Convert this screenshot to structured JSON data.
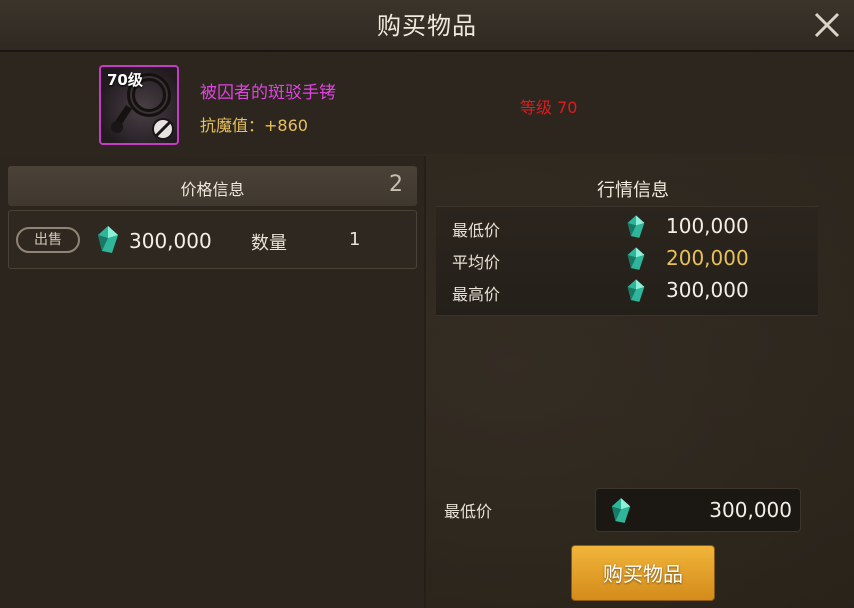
{
  "window": {
    "title": "购买物品"
  },
  "item": {
    "level_badge": "70级",
    "name": "被囚者的斑驳手铐",
    "stat": "抗魔值：+860",
    "level_requirement": "等级 70",
    "icon": "handcuff-icon",
    "name_color": "#e044e0"
  },
  "price_info": {
    "title": "价格信息",
    "count": "2",
    "listings": [
      {
        "tag": "出售",
        "price": "300,000",
        "qty_label": "数量",
        "qty": "1"
      }
    ]
  },
  "market_info": {
    "title": "行情信息",
    "rows": [
      {
        "label": "最低价",
        "value": "100,000"
      },
      {
        "label": "平均价",
        "value": "200,000"
      },
      {
        "label": "最高价",
        "value": "300,000"
      }
    ]
  },
  "purchase": {
    "lowest_label": "最低价",
    "price_value": "300,000",
    "buy_label": "购买物品"
  },
  "colors": {
    "accent": "#e8c05a",
    "button": "#f1b53a",
    "rarity": "#c43bc4"
  }
}
